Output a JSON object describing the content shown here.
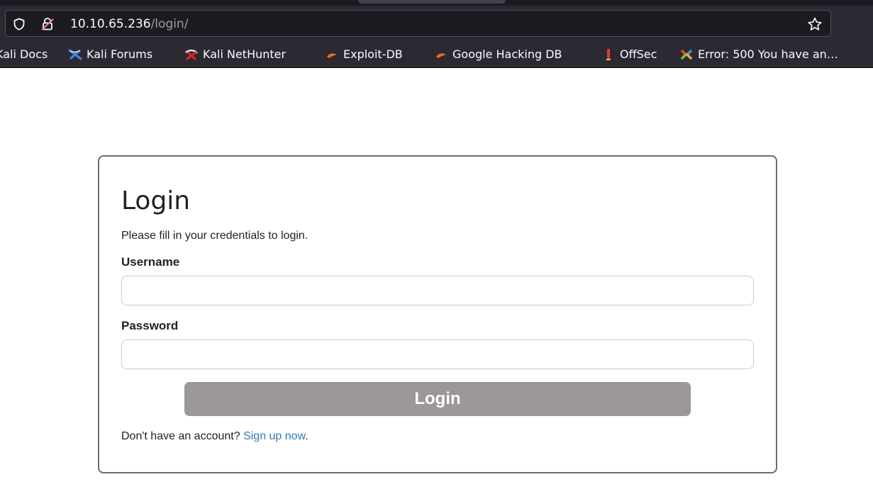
{
  "browser": {
    "url_host": "10.10.65.236",
    "url_path": "/login/",
    "bookmarks": [
      {
        "label": "Kali Docs",
        "icon": "kali-docs-icon"
      },
      {
        "label": "Kali Forums",
        "icon": "kali-forums-icon"
      },
      {
        "label": "Kali NetHunter",
        "icon": "kali-nethunter-icon"
      },
      {
        "label": "Exploit-DB",
        "icon": "exploit-db-icon"
      },
      {
        "label": "Google Hacking DB",
        "icon": "google-hacking-db-icon"
      },
      {
        "label": "OffSec",
        "icon": "offsec-icon"
      },
      {
        "label": "Error: 500 You have an…",
        "icon": "joomla-icon"
      }
    ]
  },
  "login": {
    "title": "Login",
    "subtitle": "Please fill in your credentials to login.",
    "username_label": "Username",
    "username_value": "",
    "password_label": "Password",
    "password_value": "",
    "submit_label": "Login",
    "signup_prefix": "Don't have an account? ",
    "signup_link": "Sign up now",
    "signup_suffix": "."
  },
  "colors": {
    "link": "#337ab7",
    "button_bg": "#9b9897",
    "chrome_bg": "#2b2a33"
  }
}
